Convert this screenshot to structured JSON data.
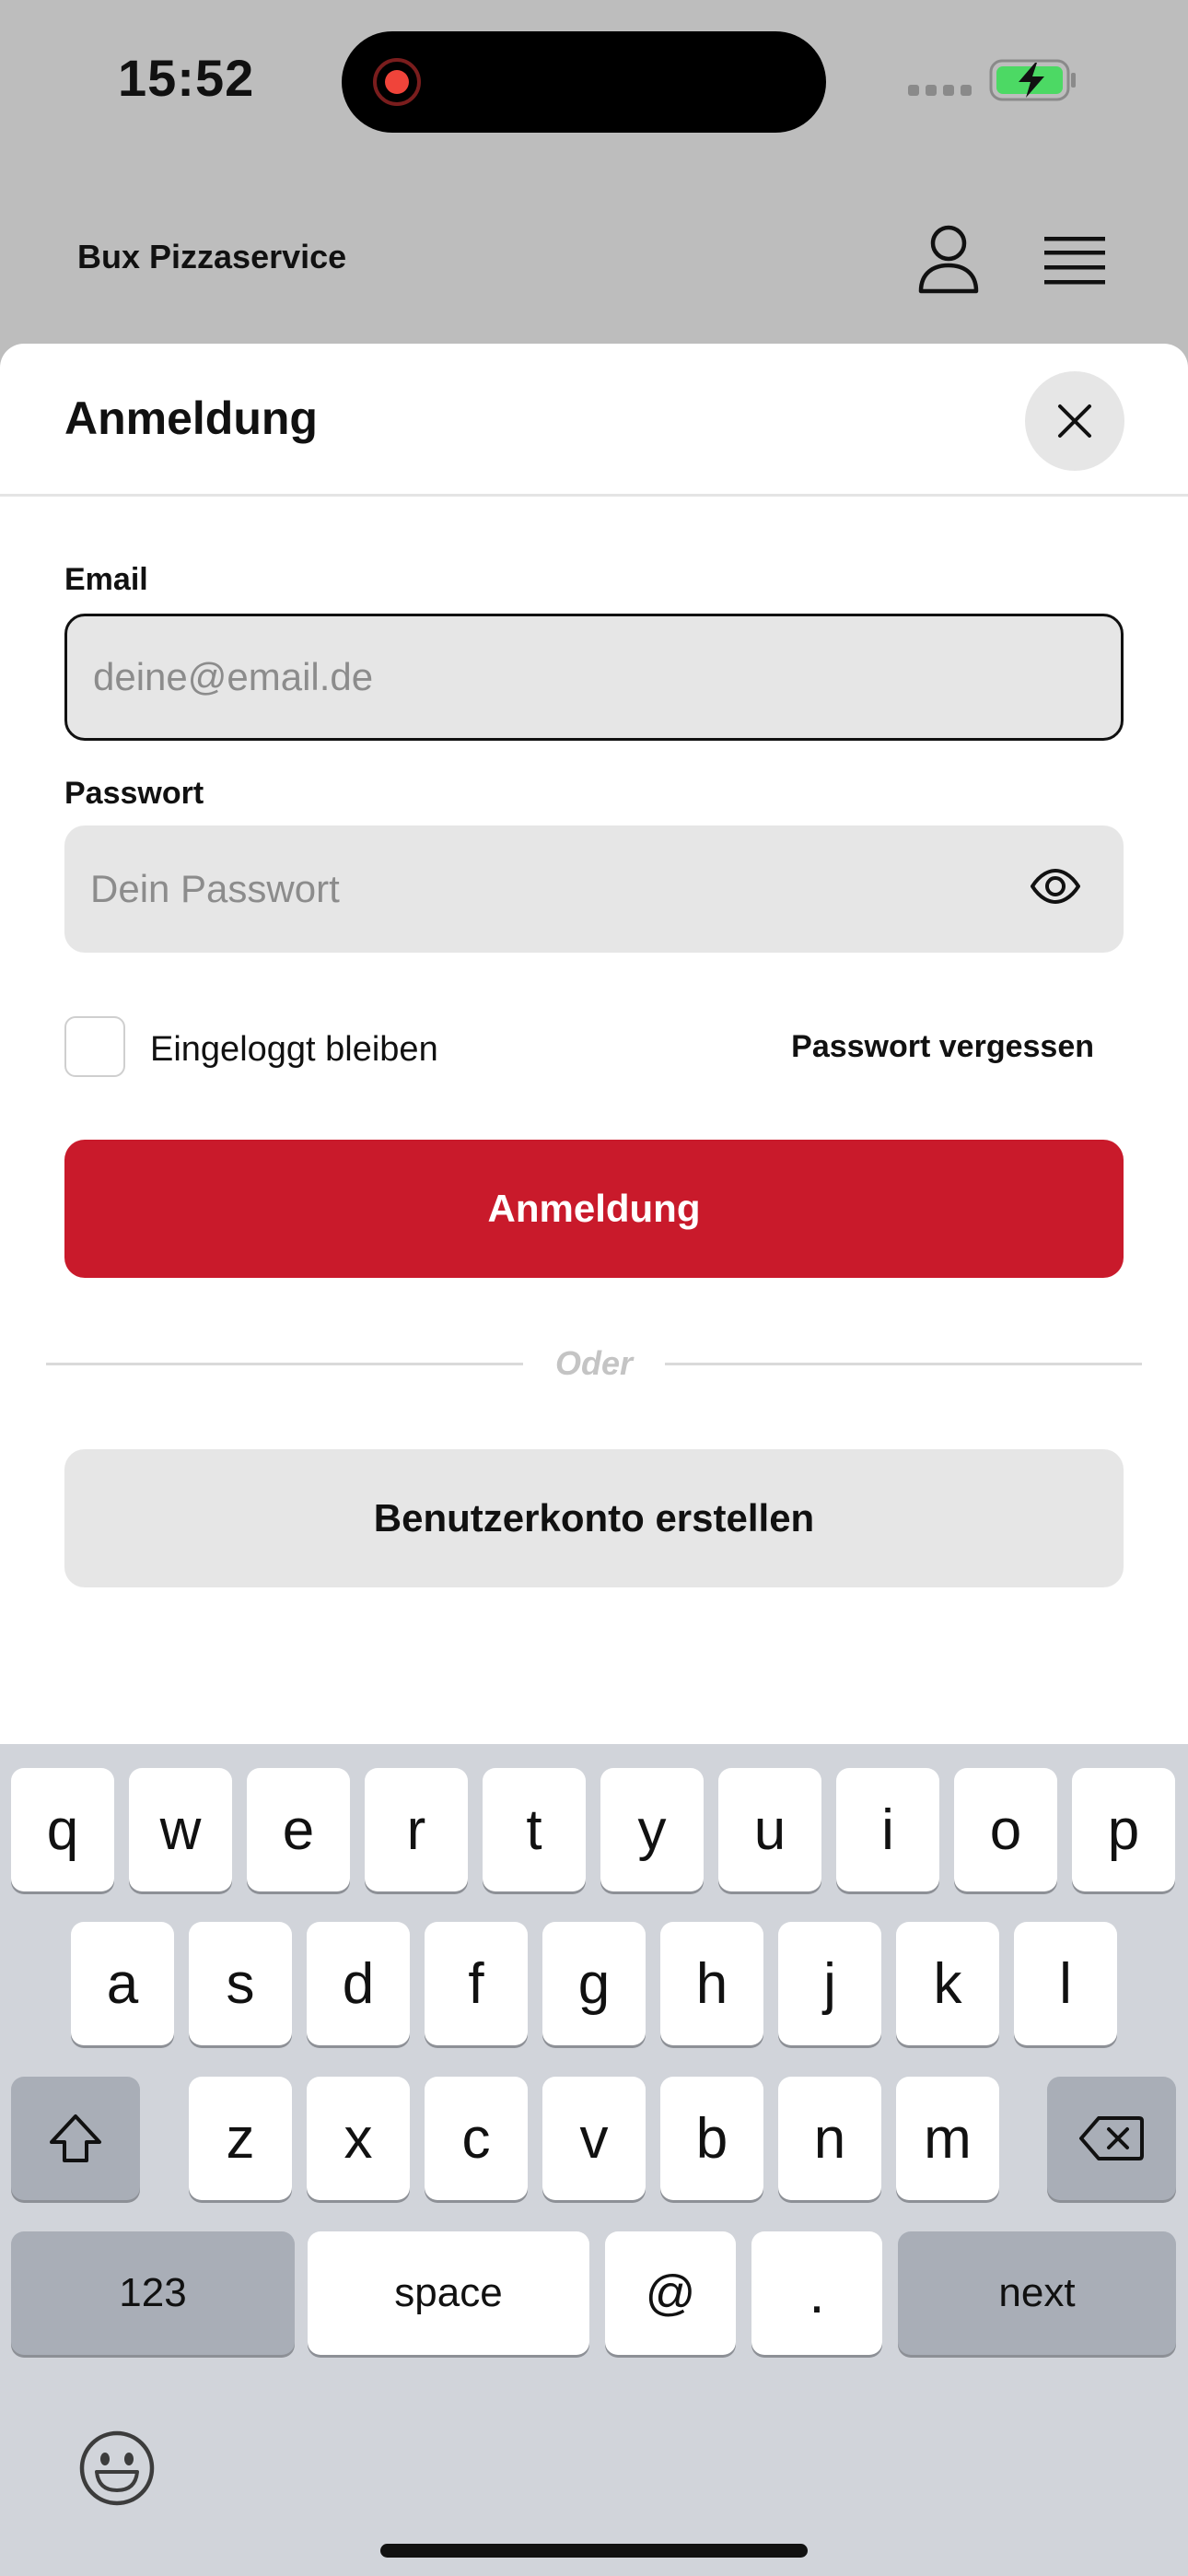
{
  "status_bar": {
    "time": "15:52"
  },
  "header": {
    "brand": "Bux Pizzaservice",
    "user_icon": "user-icon",
    "menu_icon": "hamburger-menu-icon"
  },
  "sheet": {
    "title": "Anmeldung",
    "close_icon": "close-icon",
    "email": {
      "label": "Email",
      "placeholder": "deine@email.de",
      "value": ""
    },
    "password": {
      "label": "Passwort",
      "placeholder": "Dein Passwort",
      "value": "",
      "toggle_icon": "eye-icon"
    },
    "remember_me": {
      "label": "Eingeloggt bleiben",
      "checked": false
    },
    "forgot_password": "Passwort vergessen",
    "login_button": "Anmeldung",
    "divider_text": "Oder",
    "create_account_button": "Benutzerkonto erstellen",
    "colors": {
      "primary": "#c91a2b",
      "input_bg": "#e6e6e6"
    }
  },
  "keyboard": {
    "row1": [
      "q",
      "w",
      "e",
      "r",
      "t",
      "y",
      "u",
      "i",
      "o",
      "p"
    ],
    "row2": [
      "a",
      "s",
      "d",
      "f",
      "g",
      "h",
      "j",
      "k",
      "l"
    ],
    "row3": [
      "z",
      "x",
      "c",
      "v",
      "b",
      "n",
      "m"
    ],
    "numbers_key": "123",
    "space_key": "space",
    "at_key": "@",
    "dot_key": ".",
    "return_key": "next",
    "shift_icon": "shift-icon",
    "delete_icon": "backspace-icon",
    "emoji_icon": "emoji-icon"
  }
}
